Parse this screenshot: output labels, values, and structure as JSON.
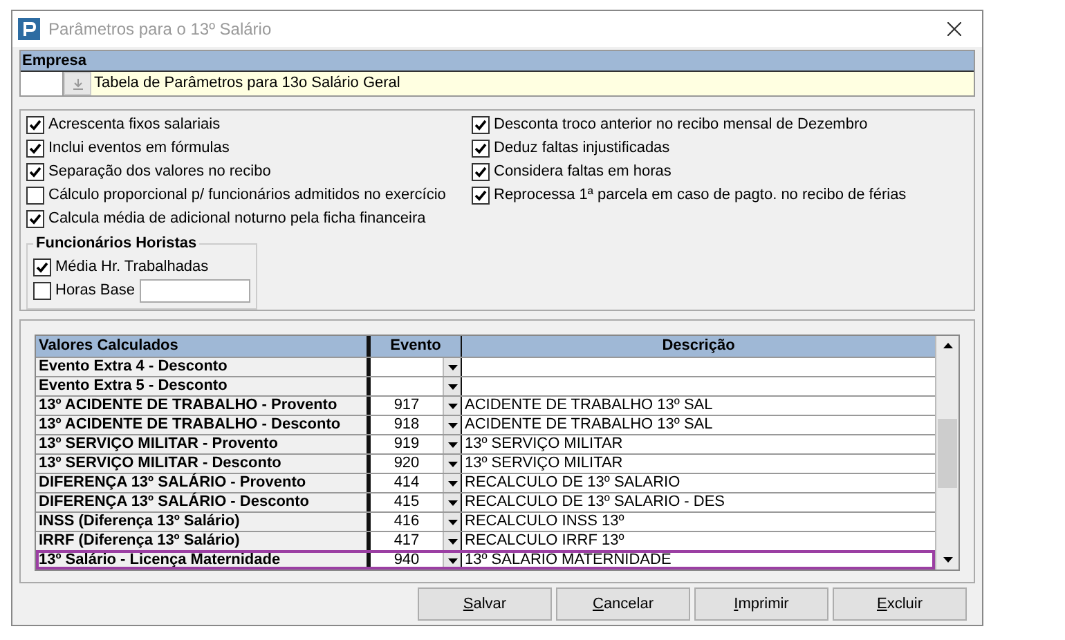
{
  "window": {
    "title": "Parâmetros para o 13º Salário"
  },
  "empresa": {
    "label": "Empresa",
    "description": "Tabela de Parâmetros para 13o Salário Geral"
  },
  "options_left": [
    {
      "label": "Acrescenta fixos salariais",
      "checked": true
    },
    {
      "label": "Inclui eventos em fórmulas",
      "checked": true
    },
    {
      "label": "Separação dos valores no recibo",
      "checked": true
    },
    {
      "label": "Cálculo proporcional p/ funcionários admitidos no exercício",
      "checked": false
    },
    {
      "label": "Calcula média de adicional noturno pela ficha financeira",
      "checked": true
    }
  ],
  "options_right": [
    {
      "label": "Desconta troco anterior no recibo mensal de Dezembro",
      "checked": true
    },
    {
      "label": "Deduz faltas injustificadas",
      "checked": true
    },
    {
      "label": "Considera faltas em horas",
      "checked": true
    },
    {
      "label": "Reprocessa 1ª parcela em caso de pagto. no recibo de férias",
      "checked": true
    }
  ],
  "horistas": {
    "title": "Funcionários Horistas",
    "options": [
      {
        "label": "Média Hr. Trabalhadas",
        "checked": true
      },
      {
        "label": "Horas Base",
        "checked": false
      }
    ]
  },
  "table": {
    "columns": [
      "Valores Calculados",
      "Evento",
      "Descrição"
    ],
    "rows": [
      {
        "name": "Evento Extra 4 - Desconto",
        "selected": false
      },
      {
        "name": "Evento Extra 5 - Desconto",
        "selected": false
      },
      {
        "name": "13º ACIDENTE DE TRABALHO - Provento",
        "evento": "917",
        "descricao": "ACIDENTE DE TRABALHO 13º SAL",
        "selected": false
      },
      {
        "name": "13º ACIDENTE DE TRABALHO - Desconto",
        "evento": "918",
        "descricao": "ACIDENTE DE TRABALHO 13º SAL",
        "selected": false
      },
      {
        "name": "13º SERVIÇO MILITAR - Provento",
        "evento": "919",
        "descricao": "13º SERVIÇO MILITAR",
        "selected": false
      },
      {
        "name": "13º SERVIÇO MILITAR - Desconto",
        "evento": "920",
        "descricao": "13º SERVIÇO MILITAR",
        "selected": false
      },
      {
        "name": "DIFERENÇA 13º SALÁRIO - Provento",
        "evento": "414",
        "descricao": "RECALCULO DE 13º SALARIO",
        "selected": false
      },
      {
        "name": "DIFERENÇA 13º SALÁRIO - Desconto",
        "evento": "415",
        "descricao": "RECALCULO DE 13º SALARIO - DES",
        "selected": false
      },
      {
        "name": "INSS (Diferença 13º Salário)",
        "evento": "416",
        "descricao": "RECALCULO INSS 13º",
        "selected": false
      },
      {
        "name": "IRRF (Diferença 13º Salário)",
        "evento": "417",
        "descricao": "RECALCULO IRRF 13º",
        "selected": false
      },
      {
        "name": "13º Salário - Licença Maternidade",
        "evento": "940",
        "descricao": "13º SALARIO MATERNIDADE",
        "selected": true
      }
    ]
  },
  "buttons": [
    "Salvar",
    "Cancelar",
    "Imprimir",
    "Excluir"
  ]
}
